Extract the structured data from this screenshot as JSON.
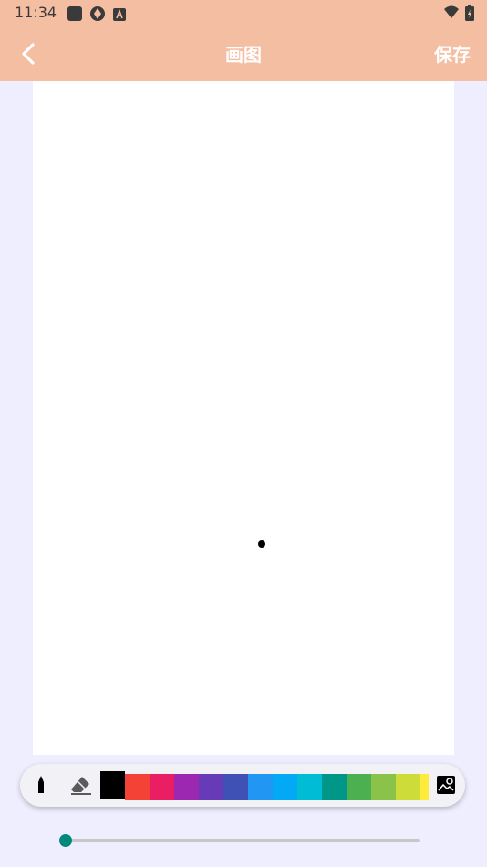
{
  "status_bar": {
    "time": "11:34",
    "left_icons": [
      "square-app-icon",
      "aperture-icon",
      "a-letter-icon"
    ],
    "right_icons": [
      "wifi-icon",
      "battery-icon"
    ]
  },
  "app_bar": {
    "title": "画图",
    "save_label": "保存",
    "back_icon": "chevron-left-icon",
    "background": "#f4bea2"
  },
  "canvas": {
    "background": "#ffffff",
    "strokes": [
      {
        "shape": "dot",
        "color": "#000000"
      }
    ]
  },
  "toolbar": {
    "pen_icon": "pen-icon",
    "eraser_icon": "eraser-icon",
    "image_icon": "image-icon",
    "selected_color": "#000000",
    "colors": [
      "#000000",
      "#f44336",
      "#e91e63",
      "#9c27b0",
      "#673ab7",
      "#3f51b5",
      "#2196f3",
      "#03a9f4",
      "#00bcd4",
      "#009688",
      "#4caf50",
      "#8bc34a",
      "#cddc39",
      "#ffeb3b"
    ]
  },
  "brush_size": {
    "value_fraction": 0.0,
    "accent": "#00897b"
  }
}
